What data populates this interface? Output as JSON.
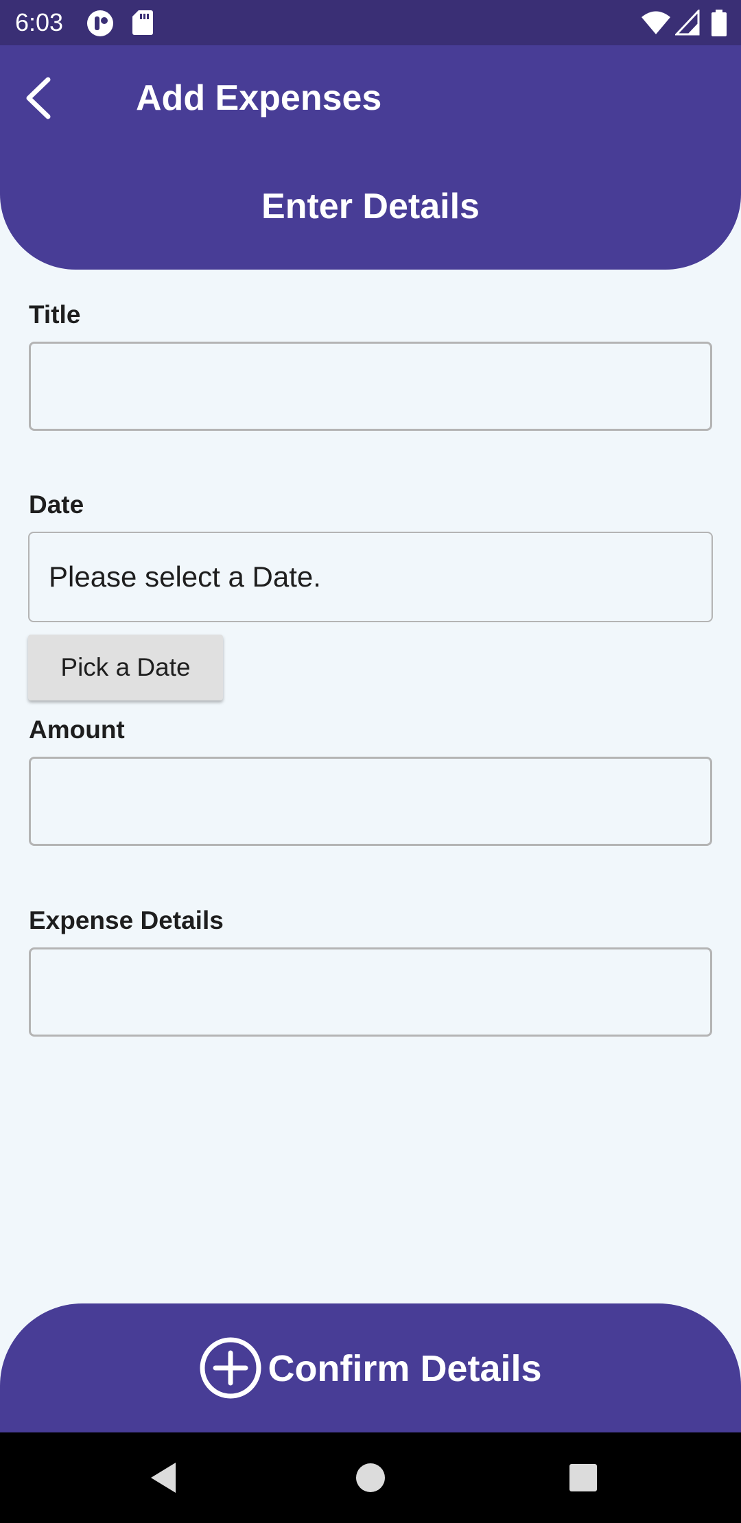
{
  "status_bar": {
    "time": "6:03",
    "left_icons": [
      "assistant-icon",
      "sd-card-icon"
    ],
    "right_icons": [
      "wifi-icon",
      "signal-icon",
      "battery-icon"
    ]
  },
  "header": {
    "title": "Add Expenses",
    "section_heading": "Enter Details",
    "back_icon": "back-arrow-icon"
  },
  "form": {
    "title_label": "Title",
    "title_value": "",
    "date_label": "Date",
    "date_value": "Please select a Date.",
    "pick_date_label": "Pick a Date",
    "amount_label": "Amount",
    "amount_value": "",
    "details_label": "Expense Details",
    "details_value": ""
  },
  "confirm": {
    "label": "Confirm Details",
    "icon": "add-circle-icon"
  },
  "nav_bar": {
    "icons": [
      "nav-back-icon",
      "nav-home-icon",
      "nav-recents-icon"
    ]
  },
  "colors": {
    "primary": "#483d96",
    "status_bar": "#3a2f75",
    "background": "#f1f7fb",
    "button_gray": "#e0e0e0"
  }
}
